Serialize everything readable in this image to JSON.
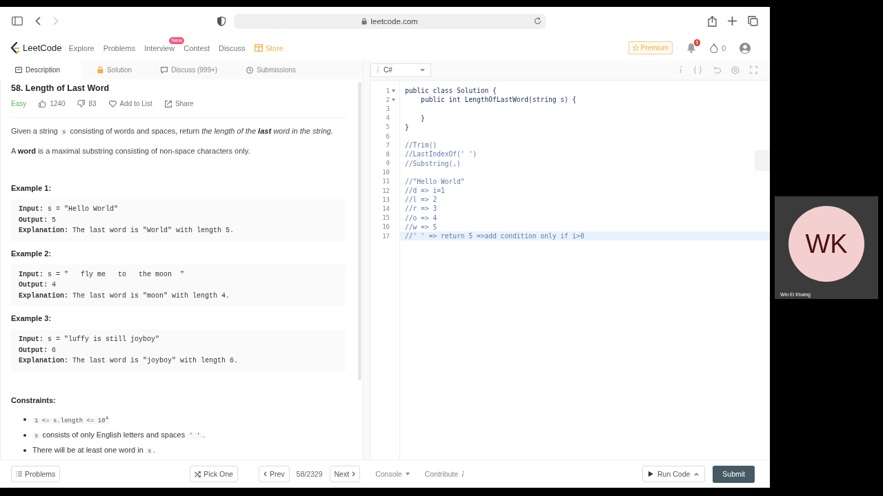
{
  "browser": {
    "address": "leetcode.com",
    "forward_disabled": true
  },
  "nav": {
    "logo": "LeetCode",
    "links": [
      {
        "label": "Explore",
        "kind": "link"
      },
      {
        "label": "Problems",
        "kind": "link"
      },
      {
        "label": "Interview",
        "badge": "New",
        "kind": "link"
      },
      {
        "label": "Contest",
        "kind": "link"
      },
      {
        "label": "Discuss",
        "kind": "link"
      },
      {
        "label": "Store",
        "kind": "store"
      }
    ],
    "premium": "Premium",
    "notifications": "5",
    "streak": "0"
  },
  "tabs": [
    {
      "label": "Description",
      "selected": true
    },
    {
      "label": "Solution",
      "selected": false
    },
    {
      "label": "Discuss (999+)",
      "selected": false
    },
    {
      "label": "Submissions",
      "selected": false
    }
  ],
  "problem": {
    "title": "58. Length of Last Word",
    "difficulty": "Easy",
    "likes": "1240",
    "dislikes": "83",
    "add_to_list": "Add to List",
    "share": "Share",
    "paragraphs": [
      [
        {
          "kind": "text",
          "text": "Given a string "
        },
        {
          "kind": "code",
          "text": "s"
        },
        {
          "kind": "text",
          "text": " consisting of words and spaces, return "
        },
        {
          "kind": "italic",
          "text": "the length of the **last** word in the string."
        }
      ],
      [
        {
          "kind": "text",
          "text": "A **word** is a maximal substring consisting of non-space characters only."
        }
      ]
    ],
    "examples": [
      {
        "title": "Example 1:",
        "lines": [
          {
            "label": "Input:",
            "value": "s = \"Hello World\""
          },
          {
            "label": "Output:",
            "value": "5"
          },
          {
            "label": "Explanation:",
            "value": "The last word is \"World\" with length 5."
          }
        ]
      },
      {
        "title": "Example 2:",
        "lines": [
          {
            "label": "Input:",
            "value": "s = \"   fly me   to   the moon  \""
          },
          {
            "label": "Output:",
            "value": "4"
          },
          {
            "label": "Explanation:",
            "value": "The last word is \"moon\" with length 4."
          }
        ]
      },
      {
        "title": "Example 3:",
        "lines": [
          {
            "label": "Input:",
            "value": "s = \"luffy is still joyboy\""
          },
          {
            "label": "Output:",
            "value": "6"
          },
          {
            "label": "Explanation:",
            "value": "The last word is \"joyboy\" with length 6."
          }
        ]
      }
    ],
    "constraints_title": "Constraints:",
    "constraints": [
      [
        {
          "kind": "code",
          "text": "1 <= s.length <= 10$^{4}$"
        }
      ],
      [
        {
          "kind": "code",
          "text": "s"
        },
        {
          "kind": "text",
          "text": " consists of only English letters and spaces "
        },
        {
          "kind": "code",
          "text": "' '"
        },
        {
          "kind": "text",
          "text": "."
        }
      ],
      [
        {
          "kind": "text",
          "text": "There will be at least one word in "
        },
        {
          "kind": "code",
          "text": "s"
        },
        {
          "kind": "text",
          "text": "."
        }
      ]
    ]
  },
  "editor": {
    "language": "C#",
    "lines": [
      {
        "number": "1",
        "kind": "code",
        "text": "public class Solution {",
        "foldable": true,
        "selected": false
      },
      {
        "number": "2",
        "kind": "code",
        "text": "    public int LengthOfLastWord(string s) {",
        "foldable": true,
        "selected": false
      },
      {
        "number": "3",
        "foldable": false,
        "selected": false
      },
      {
        "number": "4",
        "kind": "code",
        "text": "    }",
        "foldable": false,
        "selected": false
      },
      {
        "number": "5",
        "kind": "code",
        "text": "}",
        "foldable": false,
        "selected": false
      },
      {
        "number": "6",
        "foldable": false,
        "selected": false
      },
      {
        "number": "7",
        "kind": "comment",
        "text": "//Trim()",
        "foldable": false,
        "selected": false
      },
      {
        "number": "8",
        "kind": "comment",
        "text": "//LastIndexOf(' ')",
        "foldable": false,
        "selected": false
      },
      {
        "number": "9",
        "kind": "comment",
        "text": "//Substring(,)",
        "foldable": false,
        "selected": false
      },
      {
        "number": "10",
        "foldable": false,
        "selected": false
      },
      {
        "number": "11",
        "kind": "comment",
        "text": "//\"Hello World\"",
        "foldable": false,
        "selected": false
      },
      {
        "number": "12",
        "kind": "comment",
        "text": "//d => i=1",
        "foldable": false,
        "selected": false
      },
      {
        "number": "13",
        "kind": "comment",
        "text": "//l => 2",
        "foldable": false,
        "selected": false
      },
      {
        "number": "14",
        "kind": "comment",
        "text": "//r => 3",
        "foldable": false,
        "selected": false
      },
      {
        "number": "15",
        "kind": "comment",
        "text": "//o => 4",
        "foldable": false,
        "selected": false
      },
      {
        "number": "16",
        "kind": "comment",
        "text": "//w => 5",
        "foldable": false,
        "selected": false
      },
      {
        "number": "17",
        "kind": "comment",
        "text": "//' ' => return 5 =>add condition only if i>0",
        "foldable": false,
        "selected": true
      }
    ]
  },
  "footer": {
    "problems": "Problems",
    "pick_one": "Pick One",
    "prev": "Prev",
    "counter": "58/2329",
    "next": "Next",
    "console": "Console",
    "contribute": "Contribute",
    "run_code": "Run Code",
    "submit": "Submit"
  },
  "participant": {
    "initials": "WK",
    "name": "Win Ei Khaing"
  }
}
